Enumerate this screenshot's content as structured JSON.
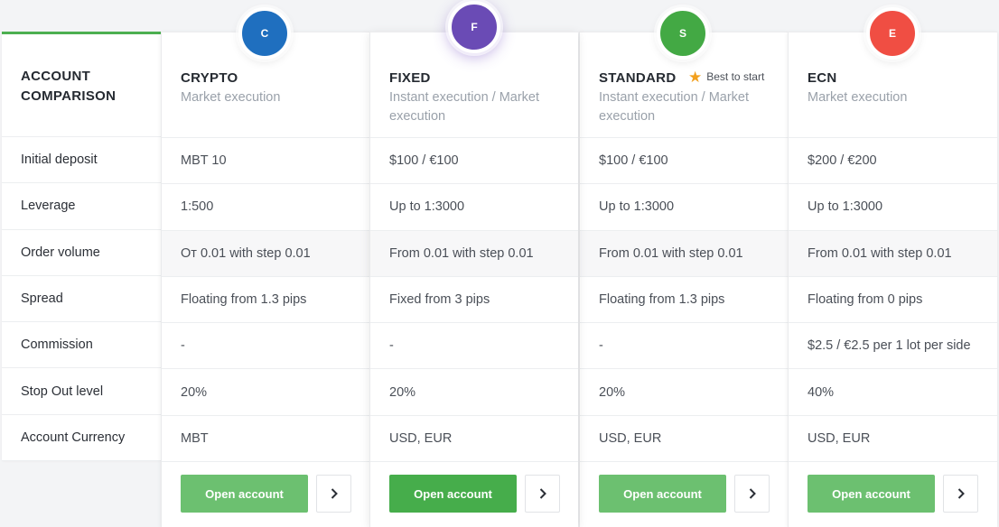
{
  "comparison": {
    "title_line1": "ACCOUNT",
    "title_line2": "COMPARISON",
    "row_labels": [
      "Initial deposit",
      "Leverage",
      "Order volume",
      "Spread",
      "Commission",
      "Stop Out level",
      "Account Currency"
    ]
  },
  "accounts": [
    {
      "name": "CRYPTO",
      "execution": "Market execution",
      "avatar_letter": "C",
      "avatar_color": "#1f6fbf",
      "values": [
        "MBT 10",
        "1:500",
        "От 0.01 with step 0.01",
        "Floating from 1.3 pips",
        "-",
        "20%",
        "MBT"
      ],
      "open_label": "Open account"
    },
    {
      "name": "FIXED",
      "execution": "Instant execution / Market execution",
      "avatar_letter": "F",
      "avatar_color": "#6a4bb5",
      "values": [
        "$100 / €100",
        "Up to 1:3000",
        "From 0.01 with step 0.01",
        "Fixed from 3 pips",
        "-",
        "20%",
        "USD, EUR"
      ],
      "open_label": "Open account"
    },
    {
      "name": "STANDARD",
      "execution": "Instant execution / Market execution",
      "badge": "Best to start",
      "avatar_letter": "S",
      "avatar_color": "#43a944",
      "values": [
        "$100 / €100",
        "Up to 1:3000",
        "From 0.01 with step 0.01",
        "Floating from 1.3 pips",
        "-",
        "20%",
        "USD, EUR"
      ],
      "open_label": "Open account"
    },
    {
      "name": "ECN",
      "execution": "Market execution",
      "avatar_letter": "E",
      "avatar_color": "#f04e43",
      "values": [
        "$200 / €200",
        "Up to 1:3000",
        "From 0.01 with step 0.01",
        "Floating from 0 pips",
        "$2.5 / €2.5 per 1 lot per side",
        "40%",
        "USD, EUR"
      ],
      "open_label": "Open account"
    }
  ],
  "colors": {
    "accent_green": "#4caf50",
    "button_green": "#6cc070",
    "button_green_active": "#46ad4b",
    "star": "#f2a01e"
  },
  "icons": {
    "star": "star-icon",
    "arrow": "chevron-right-icon"
  }
}
